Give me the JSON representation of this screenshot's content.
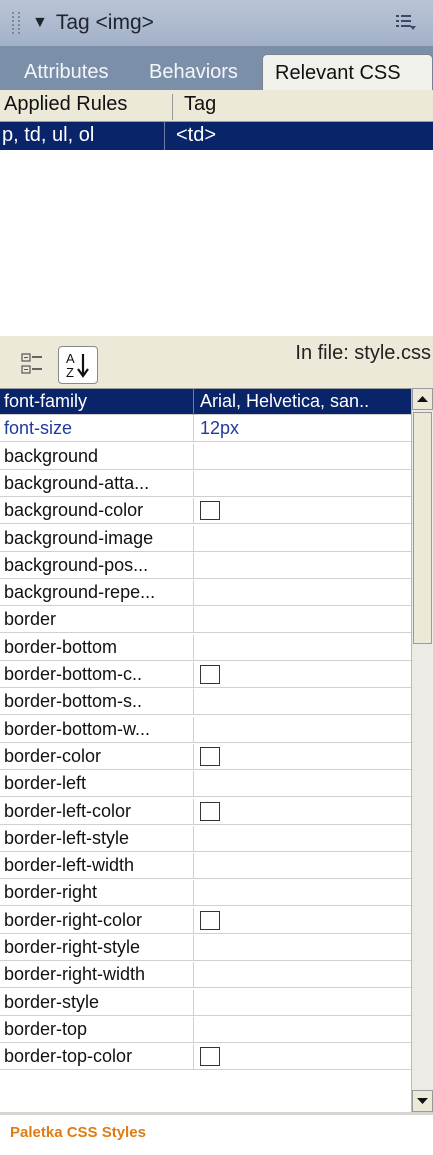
{
  "panel": {
    "title": "Tag <img>",
    "tabs": [
      "Attributes",
      "Behaviors",
      "Relevant CSS"
    ],
    "active_tab": "Relevant CSS"
  },
  "rules": {
    "columns": [
      "Applied Rules",
      "Tag"
    ],
    "rows": [
      {
        "rule": "p, td, ul, ol",
        "tag": "<td>"
      }
    ]
  },
  "toolbar": {
    "in_file": "In file: style.css"
  },
  "properties": [
    {
      "name": "font-family",
      "value": "Arial, Helvetica, san..",
      "state": "selected"
    },
    {
      "name": "font-size",
      "value": "12px",
      "state": "set"
    },
    {
      "name": "background",
      "value": ""
    },
    {
      "name": "background-atta...",
      "value": ""
    },
    {
      "name": "background-color",
      "value": "",
      "swatch": true
    },
    {
      "name": "background-image",
      "value": ""
    },
    {
      "name": "background-pos...",
      "value": ""
    },
    {
      "name": "background-repe...",
      "value": ""
    },
    {
      "name": "border",
      "value": ""
    },
    {
      "name": "border-bottom",
      "value": ""
    },
    {
      "name": "border-bottom-c..",
      "value": "",
      "swatch": true
    },
    {
      "name": "border-bottom-s..",
      "value": ""
    },
    {
      "name": "border-bottom-w...",
      "value": ""
    },
    {
      "name": "border-color",
      "value": "",
      "swatch": true
    },
    {
      "name": "border-left",
      "value": ""
    },
    {
      "name": "border-left-color",
      "value": "",
      "swatch": true
    },
    {
      "name": "border-left-style",
      "value": ""
    },
    {
      "name": "border-left-width",
      "value": ""
    },
    {
      "name": "border-right",
      "value": ""
    },
    {
      "name": "border-right-color",
      "value": "",
      "swatch": true
    },
    {
      "name": "border-right-style",
      "value": ""
    },
    {
      "name": "border-right-width",
      "value": ""
    },
    {
      "name": "border-style",
      "value": ""
    },
    {
      "name": "border-top",
      "value": ""
    },
    {
      "name": "border-top-color",
      "value": "",
      "swatch": true
    }
  ],
  "caption": "Paletka CSS Styles",
  "colors": {
    "selection": "#0a246a",
    "set_value": "#1f3aa0",
    "tab_strip": "#7b8fa8",
    "caption": "#e07b12"
  },
  "icons": [
    "panel-grip-icon",
    "expand-triangle-icon",
    "options-menu-icon",
    "category-view-icon",
    "sort-az-icon",
    "scroll-up-icon",
    "scroll-down-icon"
  ]
}
